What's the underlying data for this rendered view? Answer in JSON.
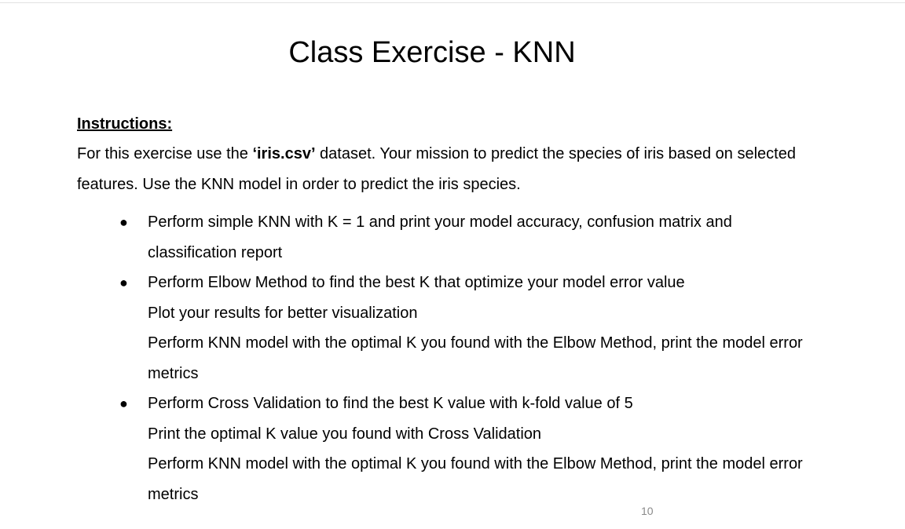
{
  "slide": {
    "title": "Class Exercise - KNN",
    "page_number": "10"
  },
  "instructions": {
    "heading": "Instructions:",
    "intro_before": "For this exercise use the ",
    "intro_dataset": "‘iris.csv’",
    "intro_after_line1": " dataset. Your mission to predict the species of iris based on selected",
    "intro_line2": "features. Use the KNN model in order to predict the iris species."
  },
  "bullets": [
    {
      "marker": "●",
      "lines": [
        "Perform simple KNN with K = 1 and print your model accuracy, confusion matrix and",
        "classification report"
      ]
    },
    {
      "marker": "●",
      "lines": [
        "Perform Elbow Method to find the best K that optimize your model error value",
        "Plot your results for better visualization",
        "Perform KNN model with the optimal K you found with the Elbow Method, print the model error",
        "metrics"
      ]
    },
    {
      "marker": "●",
      "lines": [
        "Perform Cross Validation to find the best K value with k-fold value of 5",
        "Print the optimal K value you found with Cross Validation",
        "Perform KNN model with the optimal K you found with the Elbow Method, print the model error",
        "metrics"
      ]
    }
  ]
}
